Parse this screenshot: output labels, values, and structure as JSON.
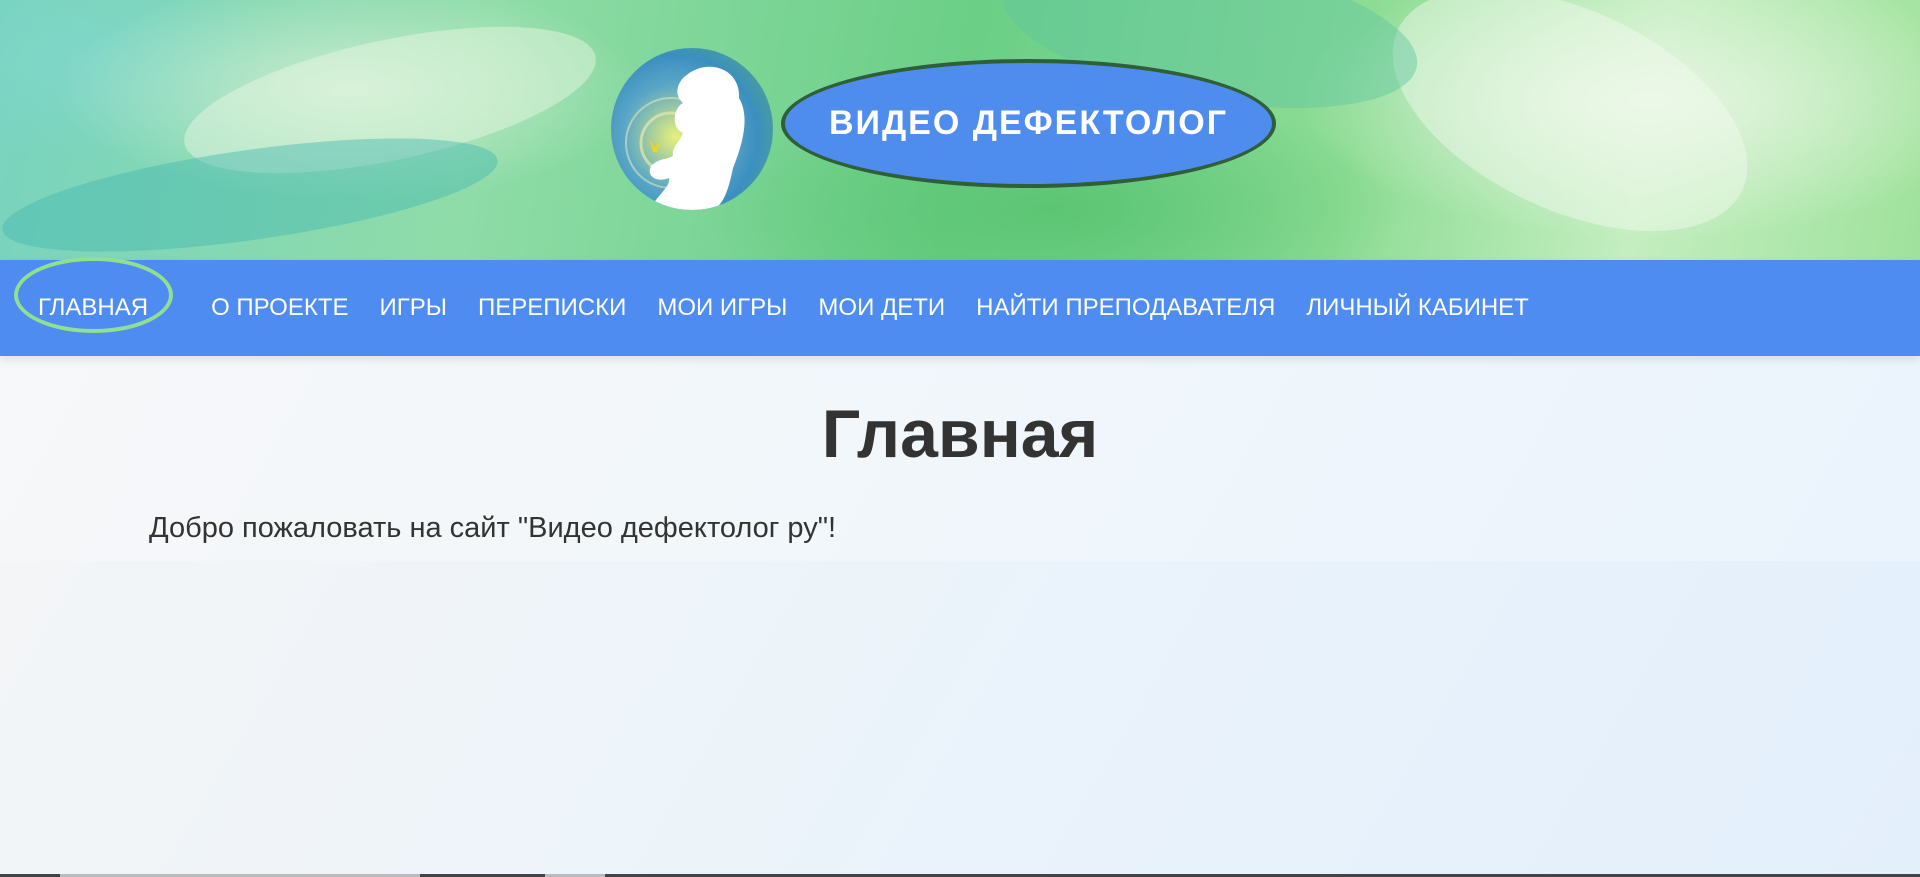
{
  "header": {
    "brand_title": "ВИДЕО ДЕФЕКТОЛОГ",
    "brand_color": "#4e8ced"
  },
  "nav": {
    "items": [
      {
        "label": "ГЛАВНАЯ",
        "active": true
      },
      {
        "label": "О ПРОЕКТЕ"
      },
      {
        "label": "ИГРЫ"
      },
      {
        "label": "ПЕРЕПИСКИ"
      },
      {
        "label": "МОИ ИГРЫ"
      },
      {
        "label": "МОИ ДЕТИ"
      },
      {
        "label": "НАЙТИ ПРЕПОДАВАТЕЛЯ"
      },
      {
        "label": "ЛИЧНЫЙ КАБИНЕТ"
      }
    ],
    "color": "#4e8cf2",
    "active_ring_color": "#8fe08f"
  },
  "main": {
    "title": "Главная",
    "welcome_text": "Добро пожаловать на сайт \"Видео дефектолог ру\"!"
  }
}
